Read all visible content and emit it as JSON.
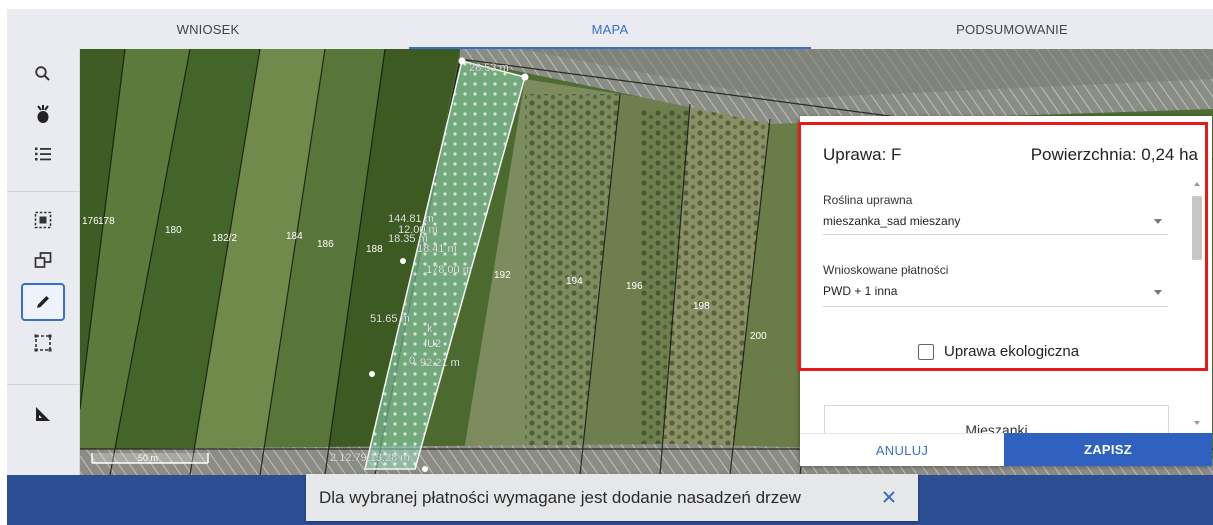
{
  "tabs": [
    {
      "label": "WNIOSEK",
      "active": false
    },
    {
      "label": "MAPA",
      "active": true
    },
    {
      "label": "PODSUMOWANIE",
      "active": false
    }
  ],
  "toolbar": [
    {
      "name": "search-icon"
    },
    {
      "name": "plant-icon"
    },
    {
      "name": "list-icon"
    },
    {
      "name": "select-area-icon"
    },
    {
      "name": "copy-icon"
    },
    {
      "name": "pencil-icon",
      "selected": true
    },
    {
      "name": "dashed-rectangle-icon"
    },
    {
      "name": "measure-icon"
    }
  ],
  "map": {
    "parcel_labels": [
      "176",
      "178",
      "180",
      "182/2",
      "184",
      "186",
      "188",
      "192",
      "194",
      "196",
      "198",
      "200"
    ],
    "measurements": [
      "28.53 m",
      "144.81 m",
      "12.00 m",
      "18.35 m",
      "18.41 m",
      "178.00 m",
      "51.65 m",
      "92.21 m",
      "2.12.79.13.28 m"
    ],
    "field_labels": [
      "k",
      "fU2",
      "0"
    ],
    "scale_label": "50 m"
  },
  "panel": {
    "title": "Uprawa: F",
    "area": "Powierzchnia: 0,24 ha",
    "crop_label": "Roślina uprawna",
    "crop_value": "mieszanka_sad mieszany",
    "payments_label": "Wnioskowane płatności",
    "payments_value": "PWD + 1 inna",
    "organic_label": "Uprawa ekologiczna",
    "organic_checked": false,
    "mixes_label": "Mieszanki",
    "cancel_label": "ANULUJ",
    "save_label": "ZAPISZ"
  },
  "snackbar": {
    "message": "Dla wybranej płatności wymagane jest dodanie nasadzeń drzew"
  },
  "colors": {
    "accent": "#3a6fc7",
    "save_button": "#2f62c0",
    "bottom_bar": "#2c4e92",
    "highlight": "#e51a1a"
  }
}
